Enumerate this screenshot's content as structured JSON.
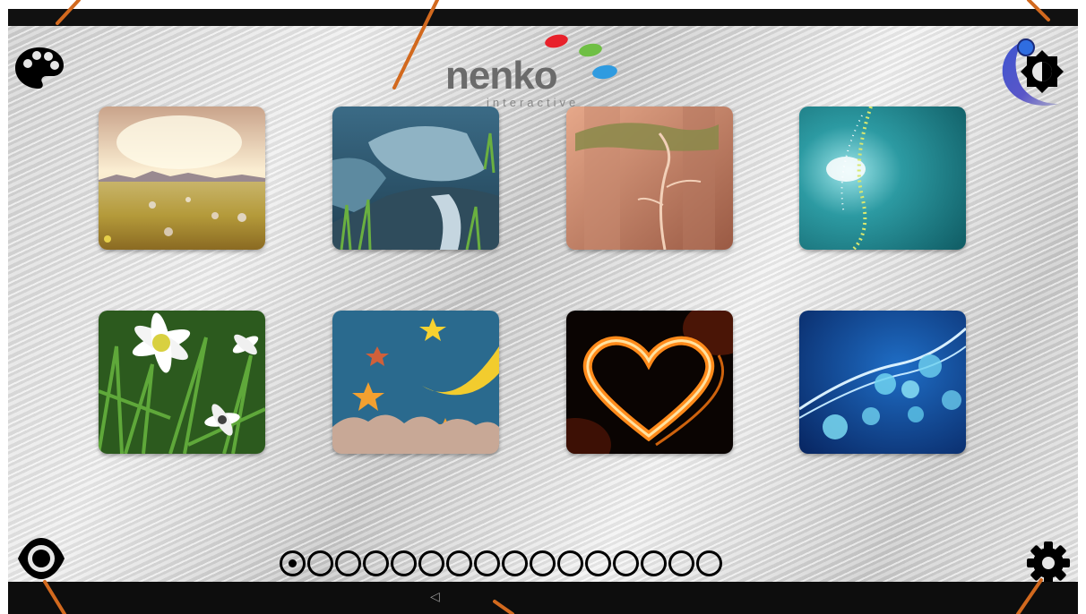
{
  "logo": {
    "word": "nenko",
    "subtitle": "interactive",
    "dot_colors": [
      "#e8212b",
      "#6fbf44",
      "#2f9be0"
    ]
  },
  "icons": {
    "palette": "palette-icon",
    "brightness": "brightness-icon",
    "eye": "eye-icon",
    "settings": "gear-icon",
    "back": "back-nav-icon"
  },
  "navbar": {
    "back_glyph": "◁"
  },
  "pager": {
    "total_pages": 16,
    "current_page": 1
  },
  "scenes": [
    {
      "id": "meadow",
      "theme": "sunny meadow"
    },
    {
      "id": "waterfall",
      "theme": "rocky waterfall"
    },
    {
      "id": "forest",
      "theme": "sepia forest tree"
    },
    {
      "id": "particles",
      "theme": "teal particle wave"
    },
    {
      "id": "daisies",
      "theme": "daisies in grass"
    },
    {
      "id": "night-sky",
      "theme": "moon and stars"
    },
    {
      "id": "fire-heart",
      "theme": "glowing fire heart"
    },
    {
      "id": "bokeh",
      "theme": "blue bokeh light waves"
    }
  ],
  "colors": {
    "callout": "#d2691e",
    "brightness_arc": "#4b63d6"
  }
}
